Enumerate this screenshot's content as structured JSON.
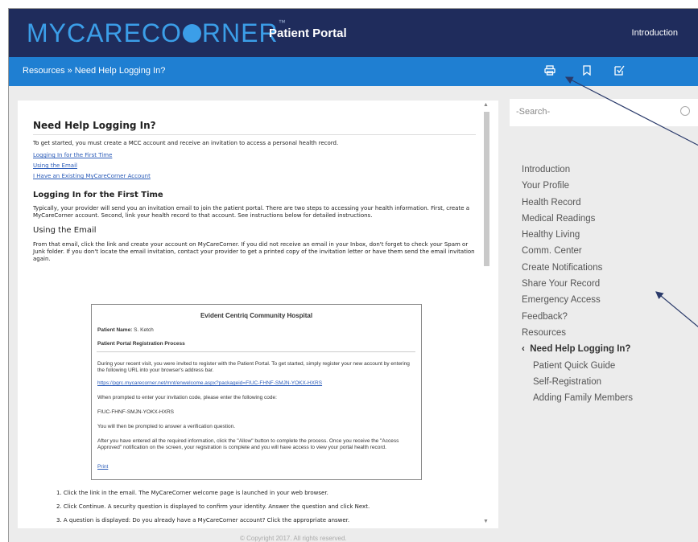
{
  "header": {
    "logo_left": "MYC",
    "logo_mid": "ARECO",
    "logo_right": "RNER",
    "logo_tm": "™",
    "portal_title": "Patient Portal",
    "nav_intro": "Introduction"
  },
  "breadcrumb": {
    "text": "Resources » Need Help Logging In?"
  },
  "toolbar": {
    "print_icon": "printer-icon",
    "bookmark_icon": "bookmark-icon",
    "edit_icon": "edit-check-icon"
  },
  "article": {
    "title": "Need Help Logging In?",
    "intro": "To get started, you must create a MCC account and receive an invitation to access a personal health record.",
    "links": [
      "Logging In for the First Time",
      "Using the Email",
      "I Have an Existing MyCareCorner Account"
    ],
    "section1_title": "Logging In for the First Time",
    "section1_text": "Typically, your provider will send you an invitation email to join the patient portal. There are two steps to accessing your health information. First, create a MyCareCorner account. Second, link your health record to that account. See instructions below for detailed instructions.",
    "section2_title": "Using the Email",
    "section2_text": "From that email, click the link and create your account on MyCareCorner. If you did not receive an email in your Inbox, don't forget to check your Spam or Junk folder. If you don't locate the email invitation, contact your provider to get a printed copy of the invitation letter or have them send the email invitation again."
  },
  "email": {
    "hospital": "Evident Centriq Community Hospital",
    "patient_label": "Patient Name:",
    "patient_name": "S. Ketch",
    "process_title": "Patient Portal Registration Process",
    "para1": "During your recent visit, you were invited to register with the Patient Portal. To get started, simply register your new account by entering the following URL into your browser's address bar.",
    "url": "https://pgrc.mycarecorner.net/mnt/enwelcome.aspx?packageid=FIUC-FHNF-SMJN-YOKX-HXRS",
    "para2": "When prompted to enter your invitation code, please enter the following code:",
    "code": "FIUC-FHNF-SMJN-YOKX-HXRS",
    "para3": "You will then be prompted to answer a verification question.",
    "para4": "After you have entered all the required information, click the \"Allow\" button to complete the process. Once you receive the \"Access Approved\" notification on the screen, your registration is complete and you will have access to view your portal health record.",
    "print": "Print"
  },
  "steps": [
    "1. Click the link in the email. The MyCareCorner welcome page is launched in your web browser.",
    "2. Click Continue. A security question is displayed to confirm your identity. Answer the question and click Next.",
    "3. A question is displayed: Do you already have a MyCareCorner account? Click the appropriate answer."
  ],
  "search": {
    "placeholder": "-Search-"
  },
  "sidebar": {
    "items": [
      "Introduction",
      "Your Profile",
      "Health Record",
      "Medical Readings",
      "Healthy Living",
      "Comm. Center",
      "Create Notifications",
      "Share Your Record",
      "Emergency Access",
      "Feedback?",
      "Resources"
    ],
    "active": "Need Help Logging In?",
    "active_icon": "chevron-left-icon",
    "sub_items": [
      "Patient Quick Guide",
      "Self-Registration",
      "Adding Family Members"
    ]
  },
  "footer": {
    "text": "© Copyright 2017. All rights reserved."
  }
}
